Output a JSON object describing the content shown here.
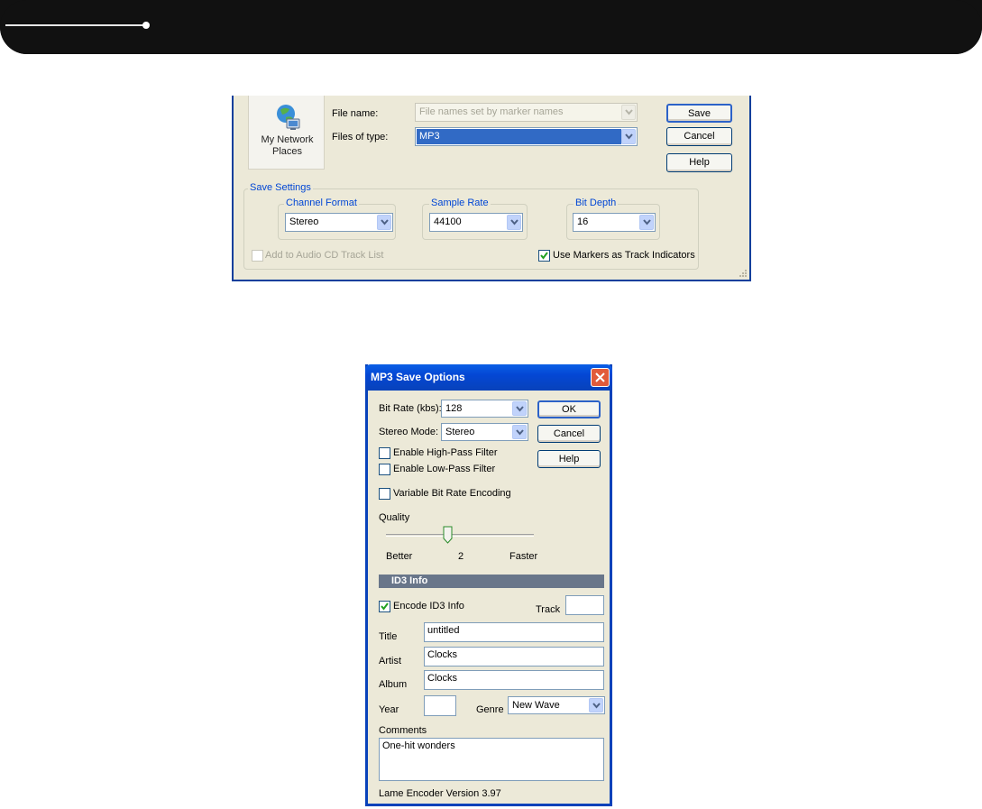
{
  "save_dialog": {
    "places_label_1": "My Network",
    "places_label_2": "Places",
    "file_name_label": "File name:",
    "file_name_value": "File names set by marker names",
    "files_of_type_label": "Files of type:",
    "files_of_type_value": "MP3",
    "save_label": "Save",
    "cancel_label": "Cancel",
    "help_label": "Help",
    "save_settings_label": "Save Settings",
    "channel_format_label": "Channel Format",
    "channel_format_value": "Stereo",
    "sample_rate_label": "Sample Rate",
    "sample_rate_value": "44100",
    "bit_depth_label": "Bit Depth",
    "bit_depth_value": "16",
    "add_cd_label": "Add to Audio CD Track List",
    "add_cd_checked": false,
    "use_markers_label": "Use Markers as Track Indicators",
    "use_markers_checked": true
  },
  "mp3_dialog": {
    "title": "MP3 Save Options",
    "bit_rate_label": "Bit Rate (kbs):",
    "bit_rate_value": "128",
    "stereo_mode_label": "Stereo Mode:",
    "stereo_mode_value": "Stereo",
    "ok_label": "OK",
    "cancel_label": "Cancel",
    "help_label": "Help",
    "high_pass_label": "Enable High-Pass Filter",
    "low_pass_label": "Enable Low-Pass Filter",
    "vbr_label": "Variable Bit Rate Encoding",
    "quality_label": "Quality",
    "quality_better": "Better",
    "quality_value": "2",
    "quality_faster": "Faster",
    "quality_level_fraction": 0.42,
    "id3_section": "ID3 Info",
    "encode_id3_label": "Encode ID3 Info",
    "encode_id3_checked": true,
    "track_label": "Track",
    "track_value": "",
    "title_label": "Title",
    "title_value": "untitled",
    "artist_label": "Artist",
    "artist_value": "Clocks",
    "album_label": "Album",
    "album_value": "Clocks",
    "year_label": "Year",
    "year_value": "",
    "genre_label": "Genre",
    "genre_value": "New Wave",
    "comments_label": "Comments",
    "comments_value": "One-hit wonders",
    "version_text": "Lame Encoder Version 3.97"
  },
  "colors": {
    "banner": "#111111",
    "dialog_face": "#ece9d8",
    "title_bar": "#0842ba",
    "selection": "#316ac5",
    "group_title": "#0046d5"
  }
}
